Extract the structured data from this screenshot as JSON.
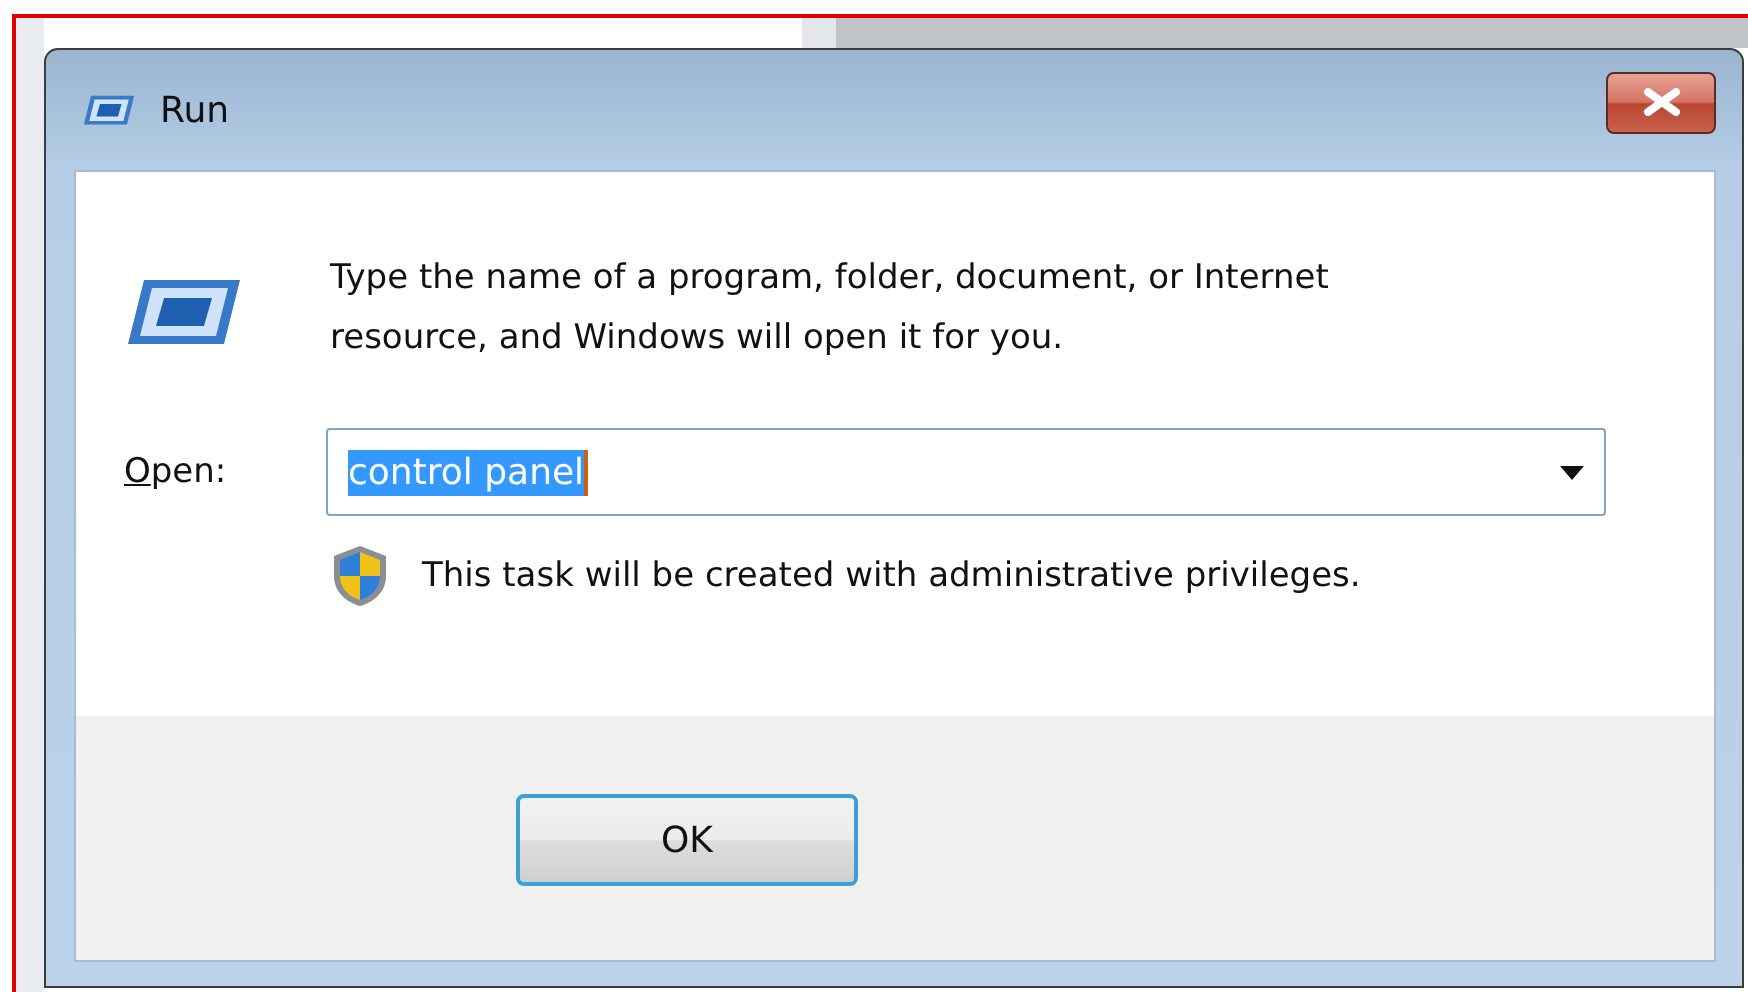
{
  "window": {
    "title": "Run"
  },
  "message": "Type the name of a program, folder, document, or Internet resource, and Windows will open it for you.",
  "open_field": {
    "label": "Open:",
    "value": "control panel",
    "value_selected": true
  },
  "admin_note": "This task will be created with administrative privileges.",
  "buttons": [
    {
      "label": "OK",
      "kind": "default"
    }
  ]
}
